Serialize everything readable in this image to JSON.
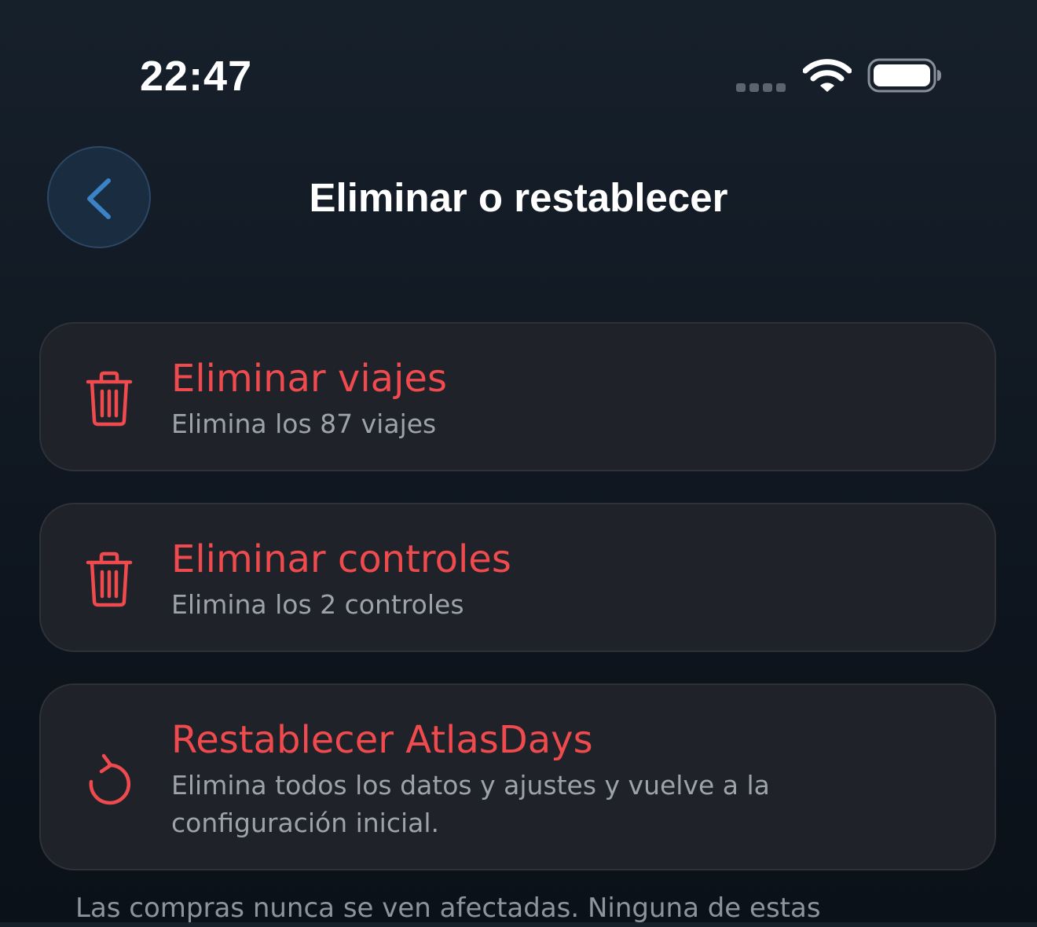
{
  "status_bar": {
    "time": "22:47",
    "signal_icon": "cellular-signal-icon",
    "wifi_icon": "wifi-icon",
    "battery_icon": "battery-icon",
    "battery_level": 1.0
  },
  "header": {
    "back_icon": "chevron-left-icon",
    "title": "Eliminar o restablecer"
  },
  "options": [
    {
      "icon": "trash-icon",
      "title": "Eliminar viajes",
      "description": "Elimina los 87 viajes"
    },
    {
      "icon": "trash-icon",
      "title": "Eliminar controles",
      "description": "Elimina los 2 controles"
    },
    {
      "icon": "reset-icon",
      "title": "Restablecer AtlasDays",
      "description": "Elimina todos los datos y ajustes y vuelve a la configuración inicial."
    }
  ],
  "footer": {
    "note": "Las compras nunca se ven afectadas. Ninguna de estas"
  },
  "colors": {
    "destructive": "#ef4a4d",
    "accent": "#3b82c6",
    "card_background": "#1f2228",
    "secondary_text": "#9ea3ab"
  }
}
